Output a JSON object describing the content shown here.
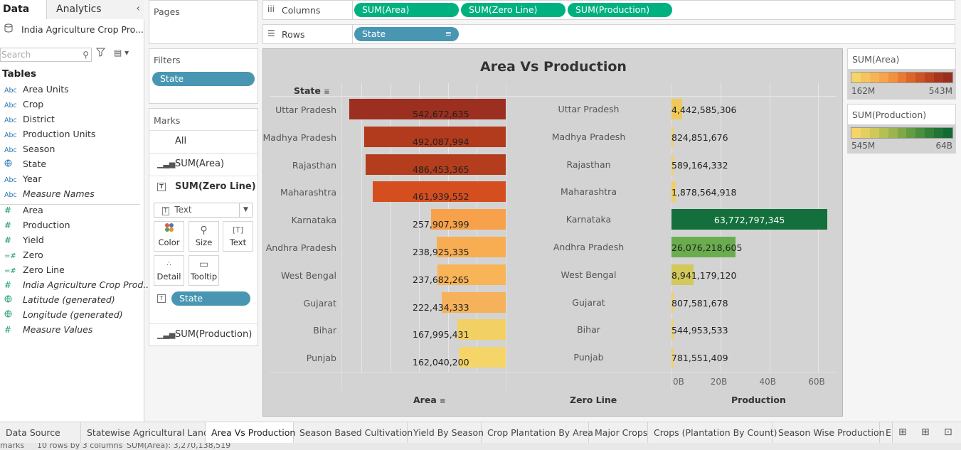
{
  "data_pane": {
    "tabs": [
      "Data",
      "Analytics"
    ],
    "datasource": "India Agriculture Crop Pro...",
    "search_placeholder": "Search",
    "tables_heading": "Tables",
    "fields": [
      {
        "type": "Abc",
        "name": "Area Units"
      },
      {
        "type": "Abc",
        "name": "Crop"
      },
      {
        "type": "Abc",
        "name": "District"
      },
      {
        "type": "Abc",
        "name": "Production Units"
      },
      {
        "type": "Abc",
        "name": "Season"
      },
      {
        "type": "globe",
        "name": "State"
      },
      {
        "type": "Abc",
        "name": "Year"
      },
      {
        "type": "Abc",
        "name": "Measure Names"
      },
      {
        "type": "#",
        "name": "Area"
      },
      {
        "type": "#",
        "name": "Production"
      },
      {
        "type": "#",
        "name": "Yield"
      },
      {
        "type": "=#",
        "name": "Zero"
      },
      {
        "type": "=#",
        "name": "Zero Line"
      },
      {
        "type": "#",
        "name": "India Agriculture Crop Prod..."
      },
      {
        "type": "globe",
        "name": "Latitude (generated)"
      },
      {
        "type": "globe",
        "name": "Longitude (generated)"
      },
      {
        "type": "#",
        "name": "Measure Values"
      }
    ]
  },
  "shelves": {
    "pages": "Pages",
    "filters": "Filters",
    "filter_pill": "State",
    "marks": "Marks",
    "columns_label": "Columns",
    "rows_label": "Rows",
    "columns": [
      "SUM(Area)",
      "SUM(Zero Line)",
      "SUM(Production)"
    ],
    "rows": [
      "State"
    ]
  },
  "marks_card": {
    "all": "All",
    "sum_area": "SUM(Area)",
    "sum_zero_line": "SUM(Zero Line)",
    "mark_type": "Text",
    "buttons": [
      "Color",
      "Size",
      "Text",
      "Detail",
      "Tooltip"
    ],
    "state_pill": "State",
    "sum_production": "SUM(Production)"
  },
  "chart_data": {
    "type": "bar",
    "title": "Area Vs Production",
    "row_header": "State",
    "categories": [
      "Uttar Pradesh",
      "Madhya Pradesh",
      "Rajasthan",
      "Maharashtra",
      "Karnataka",
      "Andhra Pradesh",
      "West Bengal",
      "Gujarat",
      "Bihar",
      "Punjab"
    ],
    "series": [
      {
        "name": "Area",
        "values": [
          542672635,
          492087994,
          486453365,
          461939552,
          257907399,
          238925335,
          237682265,
          222434333,
          167995431,
          162040200
        ],
        "labels": [
          "542,672,635",
          "492,087,994",
          "486,453,365",
          "461,939,552",
          "257,907,399",
          "238,925,335",
          "237,682,265",
          "222,434,333",
          "167,995,431",
          "162,040,200"
        ],
        "colors": [
          "#9c2f1f",
          "#b23a1d",
          "#b43d1d",
          "#d44e1f",
          "#f7a24a",
          "#f8ad53",
          "#f8b457",
          "#f5b25a",
          "#f3d063",
          "#f5d468"
        ]
      },
      {
        "name": "Zero Line",
        "values": [
          0,
          0,
          0,
          0,
          0,
          0,
          0,
          0,
          0,
          0
        ]
      },
      {
        "name": "Production",
        "values": [
          4442585306,
          824851676,
          589164332,
          1878564918,
          63772797345,
          26076218605,
          8941179120,
          807581678,
          544953533,
          781551409
        ],
        "labels": [
          "4,442,585,306",
          "824,851,676",
          "589,164,332",
          "1,878,564,918",
          "63,772,797,345",
          "26,076,218,605",
          "8,941,179,120",
          "807,581,678",
          "544,953,533",
          "781,551,409"
        ],
        "colors": [
          "#f0c95a",
          "#f3d06a",
          "#f3d06a",
          "#f0cf6a",
          "#13703c",
          "#6aad4f",
          "#d2c95a",
          "#f3d06a",
          "#f3d06a",
          "#f3d06a"
        ]
      }
    ],
    "column_headers": [
      "Area",
      "Zero Line",
      "Production"
    ],
    "production_axis": {
      "ticks": [
        "0B",
        "20B",
        "40B",
        "60B"
      ],
      "tick_values": [
        0,
        20000000000,
        40000000000,
        60000000000
      ],
      "max": 64000000000
    },
    "area_axis": {
      "max": 555000000,
      "direction": "reversed"
    },
    "grid": true
  },
  "legends": {
    "area": {
      "title": "SUM(Area)",
      "min": "162M",
      "max": "543M",
      "colors": [
        "#f5d468",
        "#f6c45f",
        "#f7b455",
        "#f8a44b",
        "#f39040",
        "#ea7a33",
        "#de6528",
        "#cd5322",
        "#bb431e",
        "#a8361c",
        "#9a2e1d"
      ]
    },
    "production": {
      "title": "SUM(Production)",
      "min": "545M",
      "max": "64B",
      "colors": [
        "#f5d468",
        "#e4cf62",
        "#cfc85a",
        "#b5c053",
        "#9ab54d",
        "#7fa947",
        "#639c42",
        "#4a8e3e",
        "#348039",
        "#217337",
        "#136a33"
      ]
    }
  },
  "sheet_tabs": [
    {
      "label": "Data Source",
      "active": false
    },
    {
      "label": "Statewise Agricultural Land",
      "active": false
    },
    {
      "label": "Area Vs Production",
      "active": true
    },
    {
      "label": "Season Based Cultivation",
      "active": false
    },
    {
      "label": "Yield By Season",
      "active": false
    },
    {
      "label": "Crop Plantation By Area",
      "active": false
    },
    {
      "label": "Major Crops",
      "active": false
    },
    {
      "label": "Crops (Plantation By Count)",
      "active": false
    },
    {
      "label": "Season Wise Production",
      "active": false
    },
    {
      "label": "E",
      "active": false
    }
  ],
  "status_bar": {
    "marks": "marks",
    "rows": "10 rows by 3 columns",
    "sum": "SUM(Area): 3,270,138,519"
  }
}
